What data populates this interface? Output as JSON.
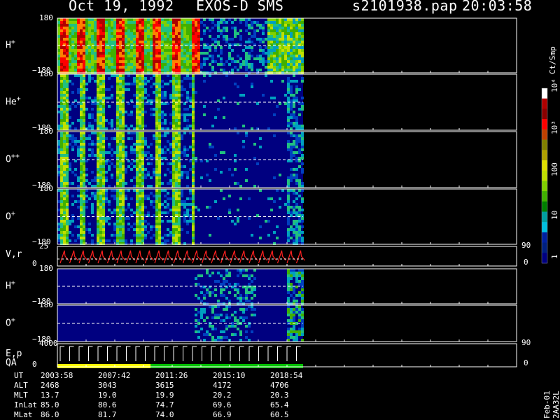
{
  "header": {
    "date": "Oct 19, 1992",
    "instrument": "EXOS-D SMS",
    "filename": "s2101938.pap",
    "time": "20:03:58"
  },
  "colorbar": {
    "unit": "Ct/Smp",
    "labels": [
      "1",
      "10",
      "100",
      "10³",
      "10⁴"
    ],
    "colors": [
      "#ffffff",
      "#b00000",
      "#8b0000",
      "#ff0000",
      "#c04000",
      "#808000",
      "#b0a000",
      "#e0e000",
      "#c0e000",
      "#80d000",
      "#40b000",
      "#008000",
      "#00a0a0",
      "#00c0e0",
      "#0020a0",
      "#002080",
      "#000080"
    ]
  },
  "chart_data": {
    "type": "heatmap",
    "title": "EXOS-D SMS",
    "panels": [
      {
        "label": "H",
        "sup": "+",
        "ymax": "180",
        "ymin": "−180",
        "intensity_profile": "high"
      },
      {
        "label": "He",
        "sup": "+",
        "ymax": "180",
        "ymin": "−180",
        "intensity_profile": "medium"
      },
      {
        "label": "O",
        "sup": "++",
        "ymax": "180",
        "ymin": "−180",
        "intensity_profile": "medium"
      },
      {
        "label": "O",
        "sup": "+",
        "ymax": "180",
        "ymin": "−180",
        "intensity_profile": "medium"
      },
      {
        "label": "V,r",
        "sup": "",
        "ymax": "25",
        "ymin": "0",
        "right_max": "90",
        "right_min": "0",
        "type": "line"
      },
      {
        "label": "H",
        "sup": "+",
        "ymax": "180",
        "ymin": "−180",
        "intensity_profile": "low"
      },
      {
        "label": "O",
        "sup": "+",
        "ymax": "180",
        "ymin": "−180",
        "intensity_profile": "low"
      },
      {
        "label": "E,p",
        "label2": "QA",
        "sup": "",
        "ymax": "4000",
        "ymin": "0",
        "right_max": "90",
        "right_min": "0",
        "type": "line"
      }
    ],
    "data_end_fraction": 0.5,
    "qa_colors": [
      "#ffff00",
      "#00c000"
    ]
  },
  "time_table": {
    "rows": [
      {
        "label": "UT",
        "values": [
          "2003:58",
          "2007:42",
          "2011:26",
          "2015:10",
          "2018:54"
        ]
      },
      {
        "label": "ALT",
        "values": [
          "2468",
          "3043",
          "3615",
          "4172",
          "4706"
        ]
      },
      {
        "label": "MLT",
        "values": [
          "13.7",
          "19.0",
          "19.9",
          "20.2",
          "20.3"
        ]
      },
      {
        "label": "InLat",
        "values": [
          "85.0",
          "80.6",
          "74.7",
          "69.6",
          "65.4"
        ]
      },
      {
        "label": "MLat",
        "values": [
          "86.0",
          "81.7",
          "74.0",
          "66.9",
          "60.5"
        ]
      }
    ]
  },
  "footer": {
    "stamp": "Feb-01 2AA32L"
  }
}
